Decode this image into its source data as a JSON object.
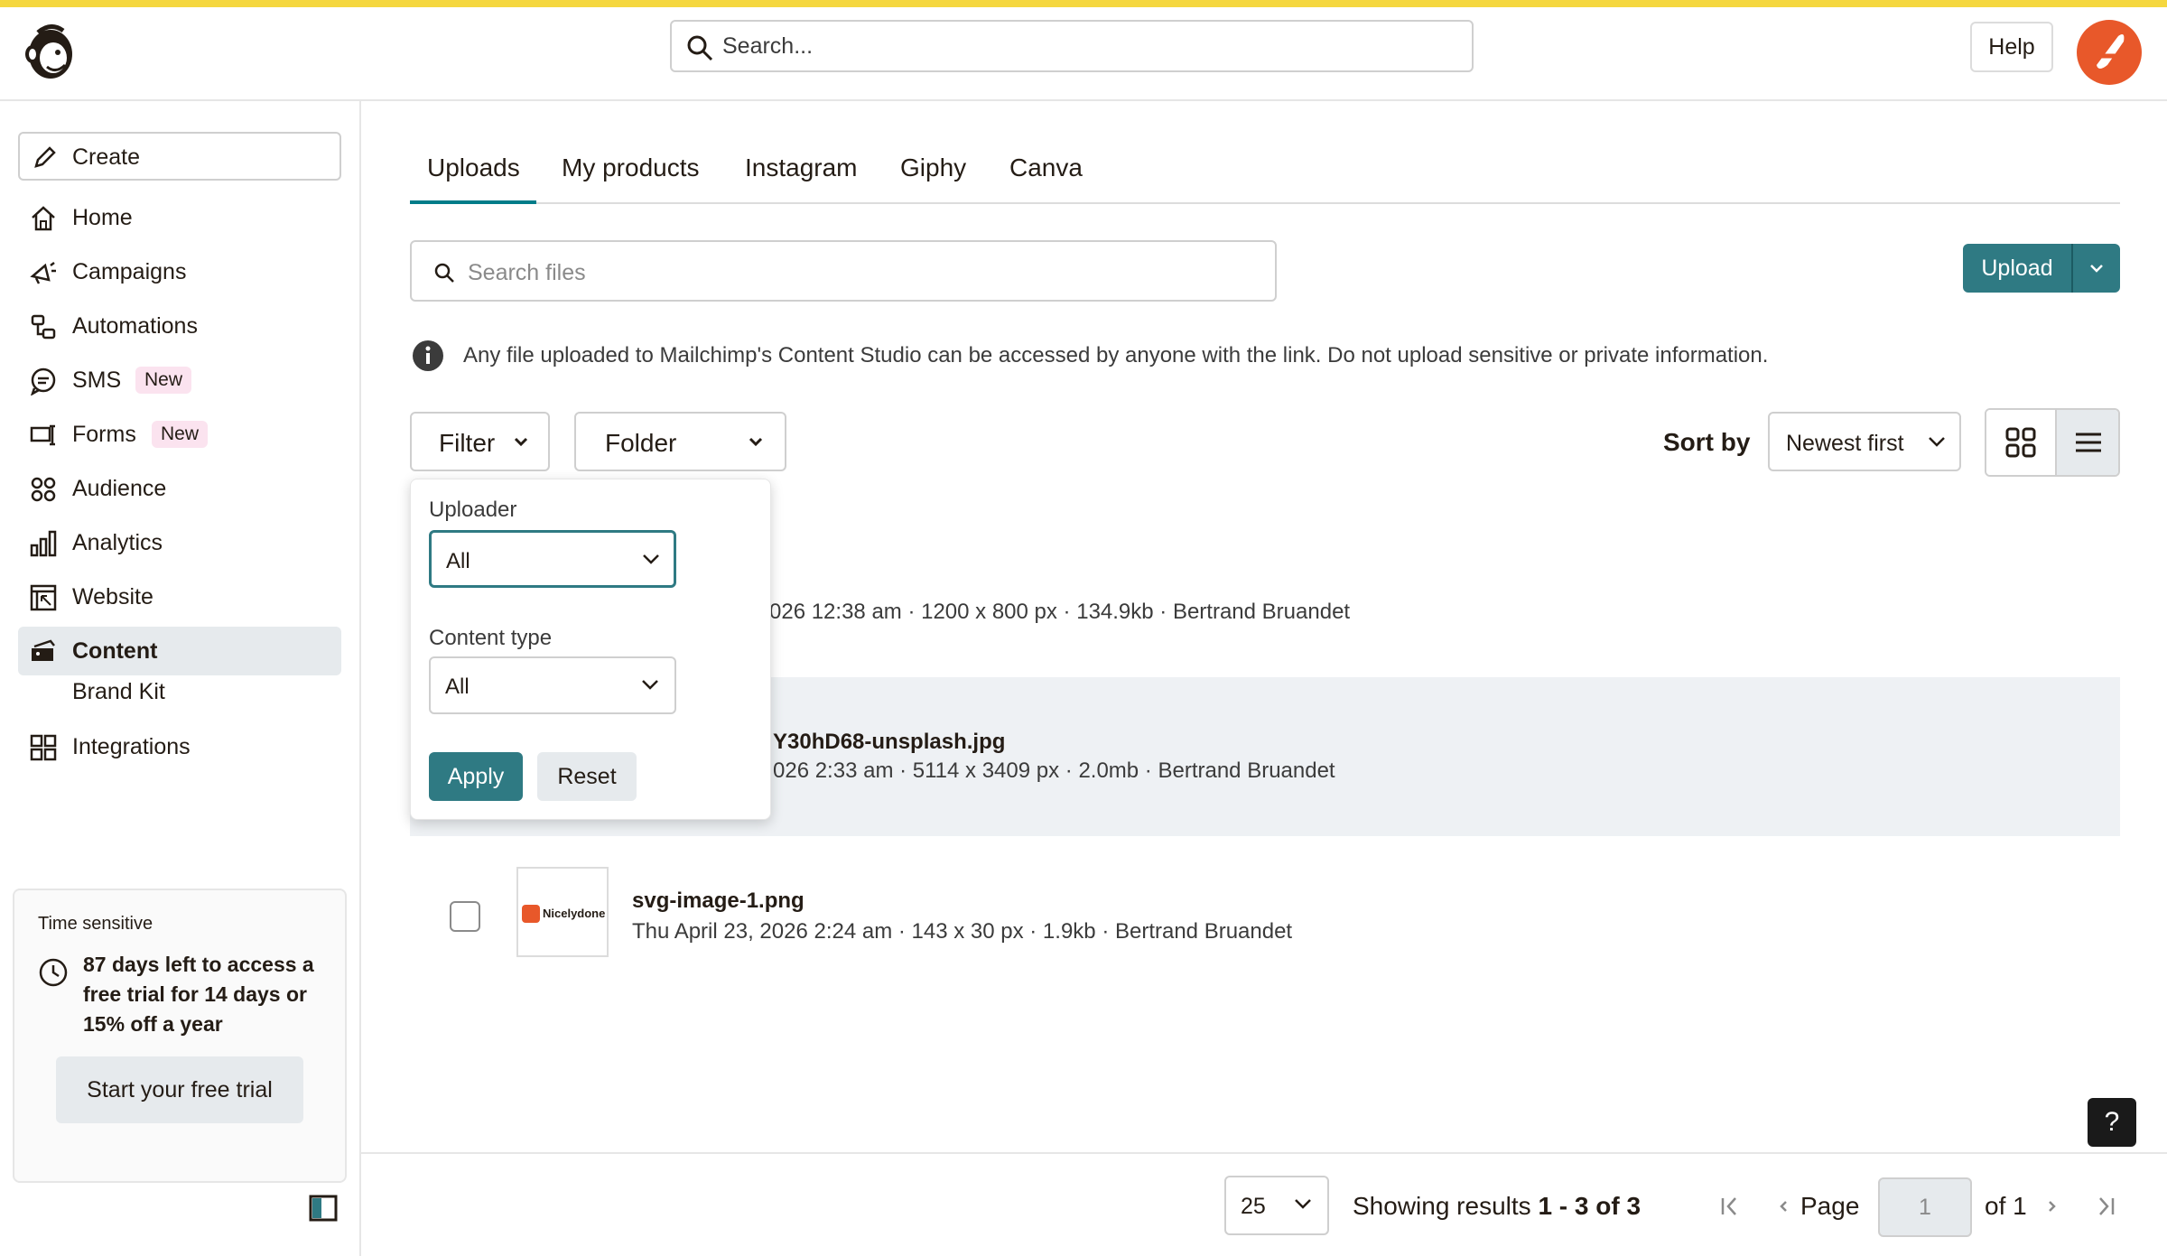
{
  "header": {
    "search_placeholder": "Search...",
    "help_label": "Help"
  },
  "sidebar": {
    "create_label": "Create",
    "items": [
      {
        "label": "Home",
        "icon": "home-icon"
      },
      {
        "label": "Campaigns",
        "icon": "megaphone-icon"
      },
      {
        "label": "Automations",
        "icon": "automation-icon"
      },
      {
        "label": "SMS",
        "icon": "sms-icon",
        "badge": "New"
      },
      {
        "label": "Forms",
        "icon": "forms-icon",
        "badge": "New"
      },
      {
        "label": "Audience",
        "icon": "audience-icon"
      },
      {
        "label": "Analytics",
        "icon": "analytics-icon"
      },
      {
        "label": "Website",
        "icon": "website-icon"
      },
      {
        "label": "Content",
        "icon": "content-icon",
        "active": true
      },
      {
        "label": "Brand Kit"
      },
      {
        "label": "Integrations",
        "icon": "integrations-icon"
      }
    ],
    "trial": {
      "kicker": "Time sensitive",
      "text": "87 days left to access a free trial for 14 days or 15% off a year",
      "button": "Start your free trial"
    }
  },
  "tabs": [
    "Uploads",
    "My products",
    "Instagram",
    "Giphy",
    "Canva"
  ],
  "active_tab": "Uploads",
  "toolbar": {
    "file_search_placeholder": "Search files",
    "upload_label": "Upload",
    "info_text": "Any file uploaded to Mailchimp's Content Studio can be accessed by anyone with the link. Do not upload sensitive or private information.",
    "filter_label": "Filter",
    "folder_label": "Folder",
    "sort_label": "Sort by",
    "sort_value": "Newest first"
  },
  "filter_popover": {
    "uploader_label": "Uploader",
    "uploader_value": "All",
    "content_type_label": "Content type",
    "content_type_value": "All",
    "apply_label": "Apply",
    "reset_label": "Reset"
  },
  "files": [
    {
      "name": "",
      "meta": "026 12:38 am · 1200 x 800 px · 134.9kb · Bertrand Bruandet"
    },
    {
      "name": "Y30hD68-unsplash.jpg",
      "meta": "026 2:33 am · 5114 x 3409 px · 2.0mb · Bertrand Bruandet"
    },
    {
      "name": "svg-image-1.png",
      "meta": "Thu April 23, 2026 2:24 am · 143 x 30 px · 1.9kb · Bertrand Bruandet",
      "thumb_text": "Nicelydone"
    }
  ],
  "footer": {
    "per_page": "25",
    "showing_prefix": "Showing results ",
    "showing_range": "1 - 3 of 3",
    "page_label": "Page",
    "page_value": "1",
    "of_label": "of 1",
    "help_fab": "?"
  },
  "colors": {
    "accent_bar": "#f5d73f",
    "primary": "#2f7a83",
    "tab_underline": "#007c89",
    "new_badge_bg": "#fbe3ef",
    "avatar": "#e8582a"
  }
}
